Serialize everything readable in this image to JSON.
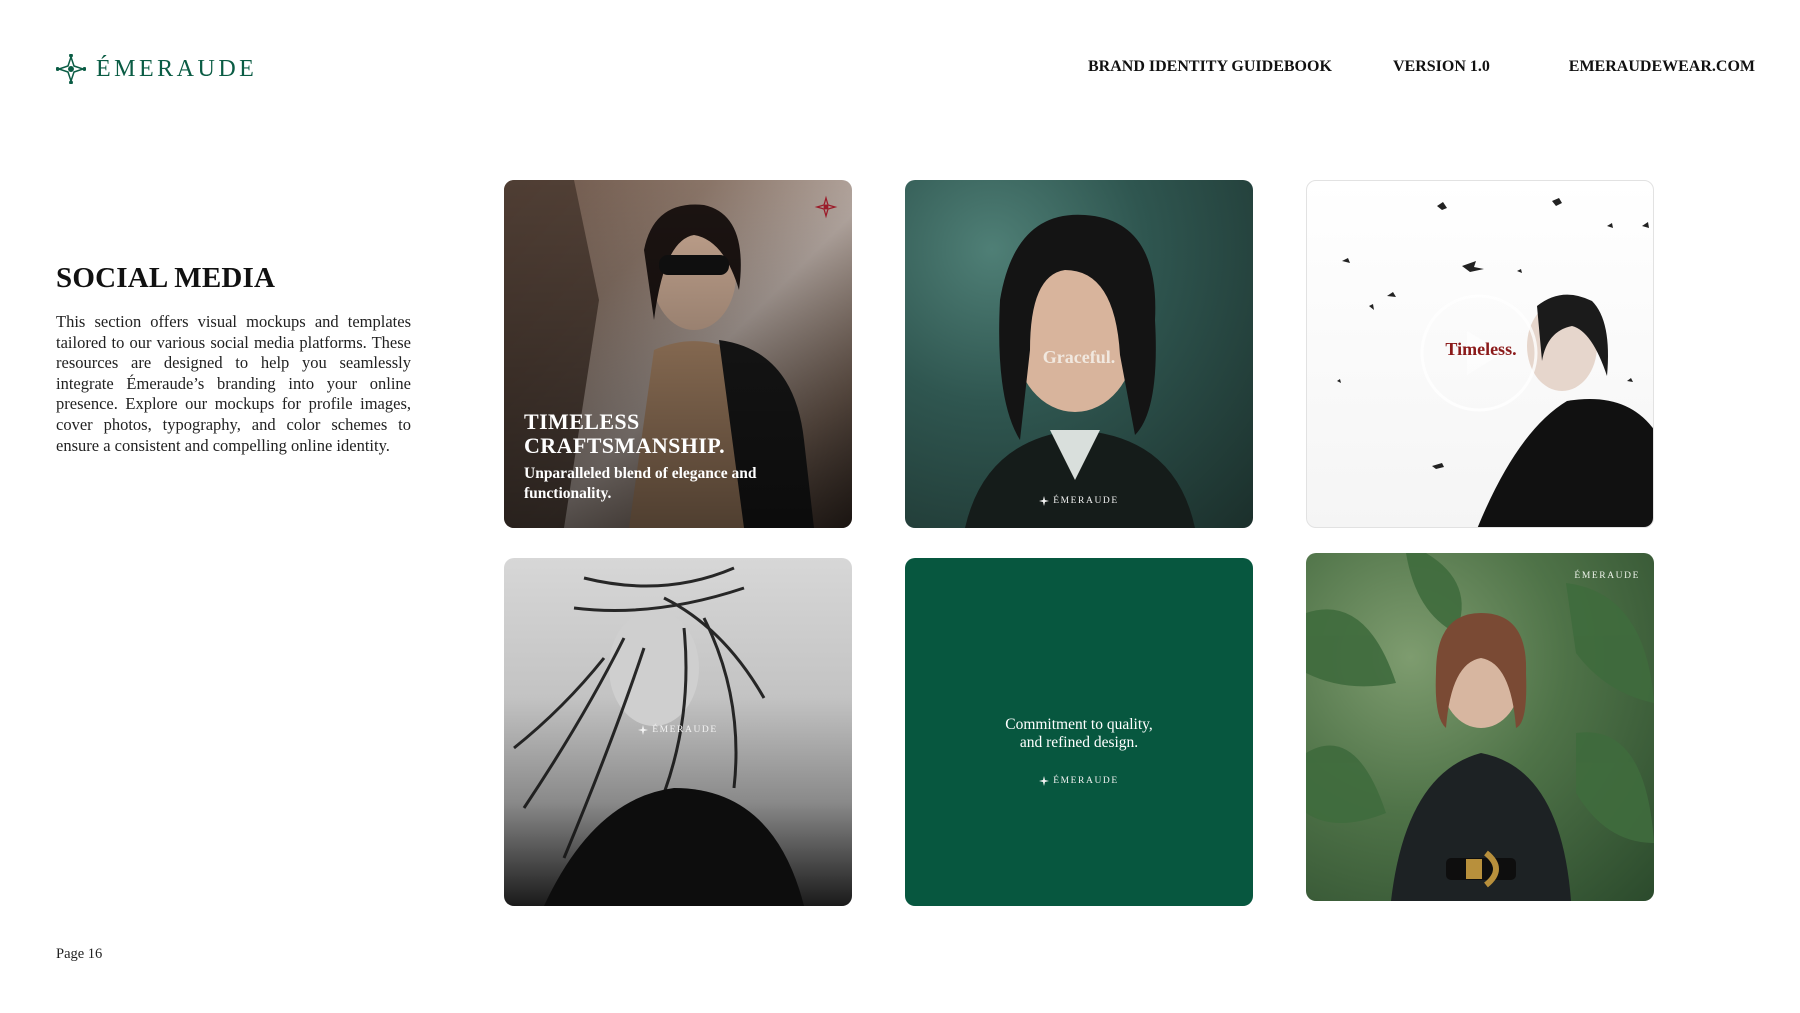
{
  "header": {
    "brand": "ÉMERAUDE",
    "nav": [
      "BRAND IDENTITY GUIDEBOOK",
      "VERSION 1.0",
      "EMERAUDEWEAR.COM"
    ]
  },
  "section": {
    "title": "SOCIAL MEDIA",
    "description": "This section offers visual mockups and templates tailored to our various social media platforms. These resources are designed to help you seamlessly integrate Émeraude’s branding into your online presence. Explore our mockups for profile images, cover photos, typography, and color schemes to ensure a consistent and compelling online identity."
  },
  "tiles": {
    "t1": {
      "headline": "TIMELESS CRAFTSMANSHIP.",
      "subline": "Unparalleled blend of elegance and functionality."
    },
    "t2": {
      "word": "Graceful.",
      "brand": "ÉMERAUDE"
    },
    "t3": {
      "word": "Timeless."
    },
    "t4": {
      "brand": "ÉMERAUDE"
    },
    "t5": {
      "quote_line1": "Commitment to quality,",
      "quote_line2": "and refined design.",
      "brand": "ÉMERAUDE"
    },
    "t6": {
      "brand": "ÉMERAUDE"
    }
  },
  "footer": {
    "page": "Page 16"
  },
  "colors": {
    "brand_green": "#07573f",
    "accent_red": "#8b1a1a"
  },
  "icons": {
    "logo": "star-compass-icon",
    "play": "play-icon"
  }
}
